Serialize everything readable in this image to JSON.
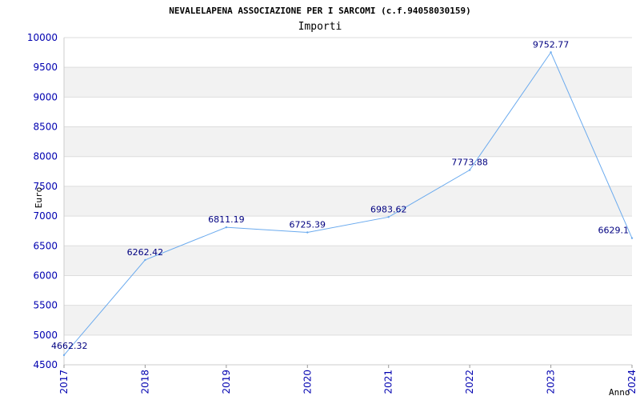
{
  "chart_data": {
    "type": "line",
    "title": "NEVALELAPENA ASSOCIAZIONE PER I SARCOMI (c.f.94058030159)",
    "subtitle": "Importi",
    "xlabel": "Anno",
    "ylabel": "Euro",
    "ylim": [
      4500,
      10000
    ],
    "yticks": [
      "4500",
      "5000",
      "5500",
      "6000",
      "6500",
      "7000",
      "7500",
      "8000",
      "8500",
      "9000",
      "9500",
      "10000"
    ],
    "categories": [
      "2017",
      "2018",
      "2019",
      "2020",
      "2021",
      "2022",
      "2023",
      "2024"
    ],
    "values": [
      4662.32,
      6262.42,
      6811.19,
      6725.39,
      6983.62,
      7773.88,
      9752.77,
      6629.1
    ],
    "value_labels": [
      "4662.32",
      "6262.42",
      "6811.19",
      "6725.39",
      "6983.62",
      "7773.88",
      "9752.77",
      "6629.1"
    ],
    "grid": "horizontal bands",
    "colors": {
      "line": "#6aaaee",
      "band": "#f2f2f2",
      "gridline": "#dddddd",
      "tick_text": "#0000b0",
      "label_text": "#000080"
    }
  }
}
